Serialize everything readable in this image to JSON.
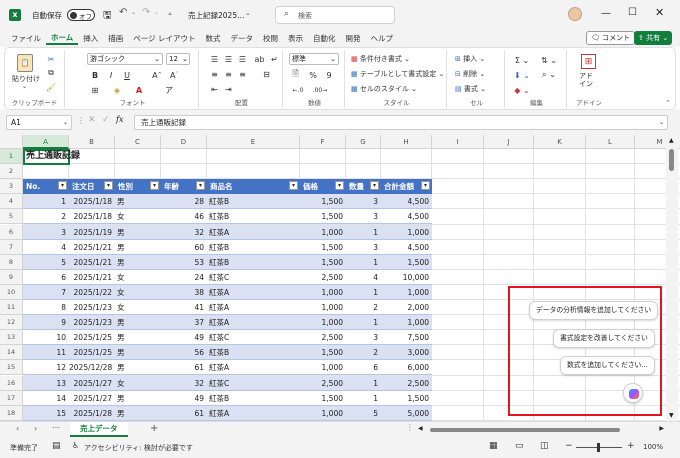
{
  "titlebar": {
    "autosave_label": "自動保存",
    "autosave_state": "オフ",
    "filename": "売上記録2025…",
    "search_placeholder": "検索"
  },
  "ribbon_tabs": [
    "ファイル",
    "ホーム",
    "挿入",
    "描画",
    "ページ レイアウト",
    "数式",
    "データ",
    "校閲",
    "表示",
    "自動化",
    "開発",
    "ヘルプ"
  ],
  "comment_label": "コメント",
  "share_label": "共有",
  "ribbon": {
    "paste": "貼り付け",
    "clipboard": "クリップボード",
    "font_name": "游ゴシック",
    "font_size": "12",
    "font": "フォント",
    "alignment": "配置",
    "number_format": "標準",
    "number": "数値",
    "cond_format": "条件付き書式",
    "table_format": "テーブルとして書式設定",
    "cell_style": "セルのスタイル",
    "styles": "スタイル",
    "insert": "挿入",
    "delete": "削除",
    "format": "書式",
    "cells": "セル",
    "editing": "編集",
    "addin": "アド\nイン",
    "addins": "アドイン"
  },
  "formula_bar": {
    "name_box": "A1",
    "fx": "fx",
    "formula": "売上通販記録"
  },
  "columns": [
    "A",
    "B",
    "C",
    "D",
    "E",
    "F",
    "G",
    "H",
    "I",
    "J",
    "K",
    "L",
    "M"
  ],
  "rows": [
    "1",
    "2",
    "3",
    "4",
    "5",
    "6",
    "7",
    "8",
    "9",
    "10",
    "11",
    "12",
    "13",
    "14",
    "15",
    "16",
    "17",
    "18"
  ],
  "sheet_title": "売上通販記録",
  "table_headers": [
    "No.",
    "注文日",
    "性別",
    "年齢",
    "商品名",
    "価格",
    "数量",
    "合計金額"
  ],
  "table_rows": [
    [
      "1",
      "2025/1/18",
      "男",
      "28",
      "紅茶B",
      "1,500",
      "3",
      "4,500"
    ],
    [
      "2",
      "2025/1/18",
      "女",
      "46",
      "紅茶B",
      "1,500",
      "3",
      "4,500"
    ],
    [
      "3",
      "2025/1/19",
      "男",
      "32",
      "紅茶A",
      "1,000",
      "1",
      "1,000"
    ],
    [
      "4",
      "2025/1/21",
      "男",
      "60",
      "紅茶B",
      "1,500",
      "3",
      "4,500"
    ],
    [
      "5",
      "2025/1/21",
      "男",
      "53",
      "紅茶B",
      "1,500",
      "1",
      "1,500"
    ],
    [
      "6",
      "2025/1/21",
      "女",
      "24",
      "紅茶C",
      "2,500",
      "4",
      "10,000"
    ],
    [
      "7",
      "2025/1/22",
      "女",
      "38",
      "紅茶A",
      "1,000",
      "1",
      "1,000"
    ],
    [
      "8",
      "2025/1/23",
      "女",
      "41",
      "紅茶A",
      "1,000",
      "2",
      "2,000"
    ],
    [
      "9",
      "2025/1/23",
      "男",
      "37",
      "紅茶A",
      "1,000",
      "1",
      "1,000"
    ],
    [
      "10",
      "2025/1/25",
      "男",
      "49",
      "紅茶C",
      "2,500",
      "3",
      "7,500"
    ],
    [
      "11",
      "2025/1/25",
      "男",
      "56",
      "紅茶B",
      "1,500",
      "2",
      "3,000"
    ],
    [
      "12",
      "2025/12/28",
      "男",
      "61",
      "紅茶A",
      "1,000",
      "6",
      "6,000"
    ],
    [
      "13",
      "2025/1/27",
      "女",
      "32",
      "紅茶C",
      "2,500",
      "1",
      "2,500"
    ],
    [
      "14",
      "2025/1/27",
      "男",
      "49",
      "紅茶B",
      "1,500",
      "1",
      "1,500"
    ],
    [
      "15",
      "2025/1/28",
      "男",
      "61",
      "紅茶A",
      "1,000",
      "5",
      "5,000"
    ]
  ],
  "copilot": {
    "suggestions": [
      "データの分析情報を追加してください",
      "書式設定を改善してください",
      "数式を追加してください..."
    ]
  },
  "sheet_tab": "売上データ",
  "status": {
    "ready": "準備完了",
    "accessibility": "アクセシビリティ: 検討が必要です",
    "zoom": "100%"
  },
  "colors": {
    "accent": "#117e3e",
    "table_header": "#4472c4",
    "band": "#d9e1f2",
    "highlight": "#e0161e"
  }
}
